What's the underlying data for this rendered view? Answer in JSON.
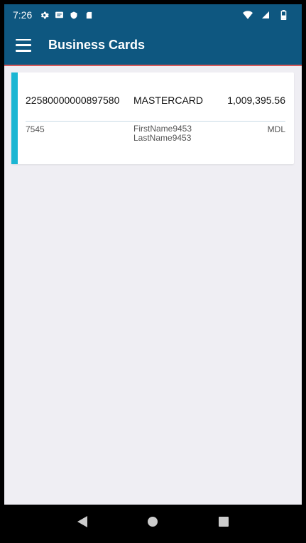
{
  "status_bar": {
    "time": "7:26",
    "left_icons": [
      "gear-icon",
      "message-icon",
      "shield-icon",
      "sd-card-icon"
    ],
    "right_icons": [
      "wifi-icon",
      "signal-icon",
      "battery-icon"
    ]
  },
  "app_bar": {
    "title": "Business Cards",
    "menu_icon": "hamburger-menu-icon",
    "color": "#0e5780"
  },
  "cards": [
    {
      "number": "22580000000897580",
      "type": "MASTERCARD",
      "amount": "1,009,395.56",
      "code": "7545",
      "holder_first": "FirstName9453",
      "holder_last": "LastName9453",
      "currency": "MDL",
      "accent_color": "#1bb6d3"
    }
  ],
  "nav_bar": {
    "buttons": [
      "back-icon",
      "home-icon",
      "recents-icon"
    ]
  }
}
